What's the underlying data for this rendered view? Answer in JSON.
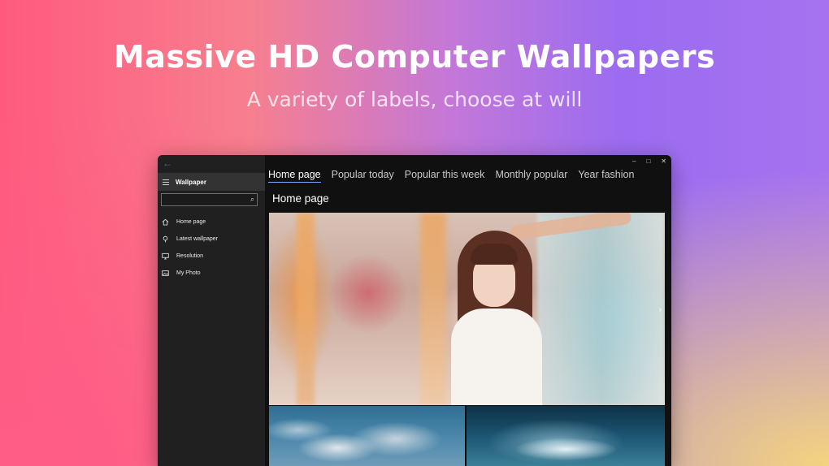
{
  "promo": {
    "headline": "Massive HD Computer Wallpapers",
    "subline": "A variety of labels, choose at will"
  },
  "app": {
    "title": "Wallpaper",
    "search": {
      "placeholder": "",
      "value": ""
    },
    "nav": [
      {
        "label": "Home page",
        "icon": "home-icon"
      },
      {
        "label": "Latest wallpaper",
        "icon": "pin-icon"
      },
      {
        "label": "Resolution",
        "icon": "monitor-icon"
      },
      {
        "label": "My Photo",
        "icon": "photo-icon"
      }
    ],
    "tabs": [
      {
        "label": "Home page",
        "active": true
      },
      {
        "label": "Popular today",
        "active": false
      },
      {
        "label": "Popular this week",
        "active": false
      },
      {
        "label": "Monthly popular",
        "active": false
      },
      {
        "label": "Year fashion",
        "active": false
      }
    ],
    "page_title": "Home page",
    "window_controls": {
      "minimize": "–",
      "maximize": "□",
      "close": "✕"
    }
  },
  "colors": {
    "accent": "#7aa7ff",
    "sidebar_bg": "#202020",
    "window_bg": "#101010"
  }
}
